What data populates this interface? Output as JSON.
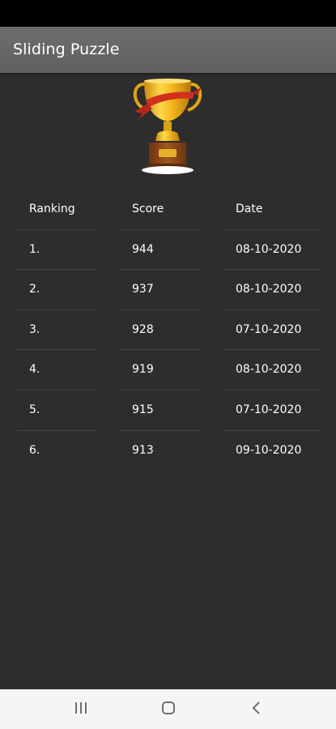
{
  "app_bar": {
    "title": "Sliding Puzzle"
  },
  "trophy": {
    "icon": "trophy-icon",
    "colors": {
      "cup": "#f2b51d",
      "ribbon": "#d0301f",
      "base": "#8b4513"
    }
  },
  "table": {
    "headers": {
      "ranking": "Ranking",
      "score": "Score",
      "date": "Date"
    },
    "rows": [
      {
        "rank": "1.",
        "score": "944",
        "date": "08-10-2020"
      },
      {
        "rank": "2.",
        "score": "937",
        "date": "08-10-2020"
      },
      {
        "rank": "3.",
        "score": "928",
        "date": "07-10-2020"
      },
      {
        "rank": "4.",
        "score": "919",
        "date": "08-10-2020"
      },
      {
        "rank": "5.",
        "score": "915",
        "date": "07-10-2020"
      },
      {
        "rank": "6.",
        "score": "913",
        "date": "09-10-2020"
      }
    ]
  },
  "nav_bar": {
    "recents_icon": "recents-icon",
    "home_icon": "home-icon",
    "back_icon": "back-icon"
  }
}
